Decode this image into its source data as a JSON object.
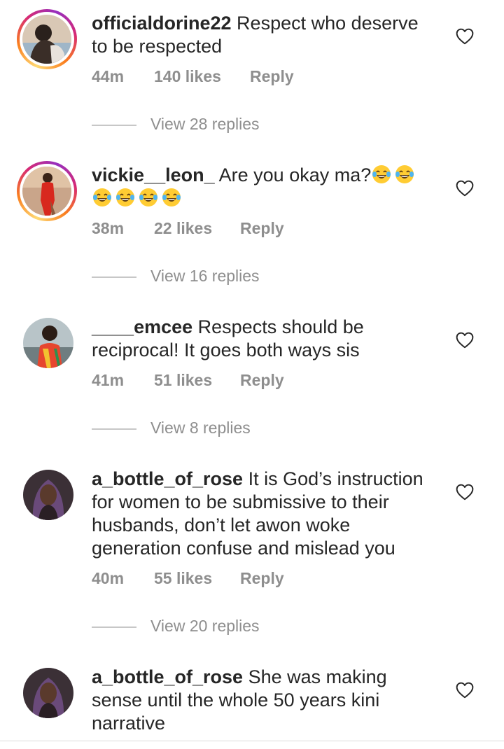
{
  "comments": [
    {
      "username": "officialdorine22",
      "text": " Respect who deserve to be respected",
      "time": "44m",
      "likes": "140 likes",
      "reply": "Reply",
      "view_replies": "View 28 replies",
      "has_story": true
    },
    {
      "username": "vickie__leon_",
      "text": " Are you okay ma?",
      "emoji_icon": "tears-of-joy-emoji-icon",
      "emoji_count": 6,
      "time": "38m",
      "likes": "22 likes",
      "reply": "Reply",
      "view_replies": "View 16 replies",
      "has_story": true
    },
    {
      "username": "____emcee",
      "text": " Respects should be reciprocal! It goes both ways sis",
      "time": "41m",
      "likes": "51 likes",
      "reply": "Reply",
      "view_replies": "View 8 replies",
      "has_story": false
    },
    {
      "username": "a_bottle_of_rose",
      "text": " It is God’s instruction for women to be submissive to their husbands, don’t let awon woke generation confuse and mislead you",
      "time": "40m",
      "likes": "55 likes",
      "reply": "Reply",
      "view_replies": "View 20 replies",
      "has_story": false
    },
    {
      "username": "a_bottle_of_rose",
      "text": " She was making sense until the whole 50 years kini narrative",
      "has_story": false
    }
  ],
  "icons": {
    "like": "heart-outline-icon"
  },
  "colors": {
    "primary_text": "#262626",
    "secondary_text": "#8e8e8e",
    "story_ring": "#d62976"
  }
}
